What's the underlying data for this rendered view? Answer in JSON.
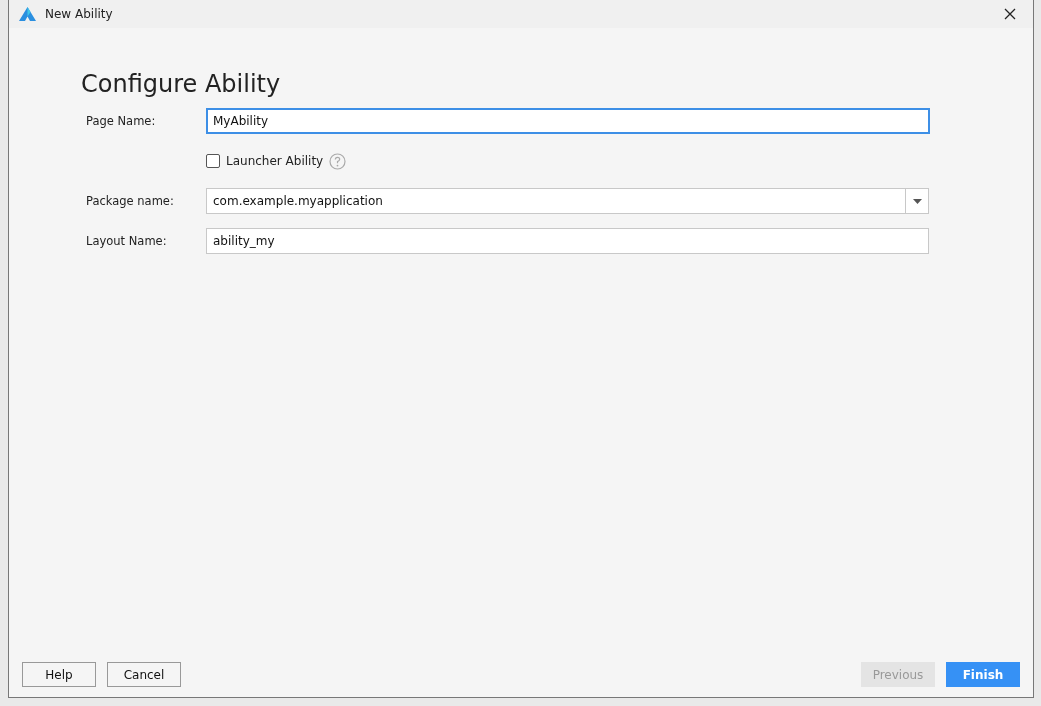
{
  "window": {
    "title": "New Ability"
  },
  "heading": "Configure Ability",
  "form": [
    {
      "kind": "text",
      "label": "Page Name:",
      "value": "MyAbility",
      "focused": true
    },
    {
      "kind": "checkbox",
      "label": "Launcher Ability",
      "checked": false
    },
    {
      "kind": "dropdown",
      "label": "Package name:",
      "value": "com.example.myapplication",
      "focused": false
    },
    {
      "kind": "text",
      "label": "Layout Name:",
      "value": "ability_my",
      "focused": false
    }
  ],
  "left_buttons": [
    {
      "label": "Help",
      "disabled": false
    },
    {
      "label": "Cancel",
      "disabled": false
    }
  ],
  "right_buttons": [
    {
      "label": "Previous",
      "kind": "plain",
      "disabled": true
    },
    {
      "label": "Finish",
      "kind": "primary",
      "disabled": false
    }
  ]
}
